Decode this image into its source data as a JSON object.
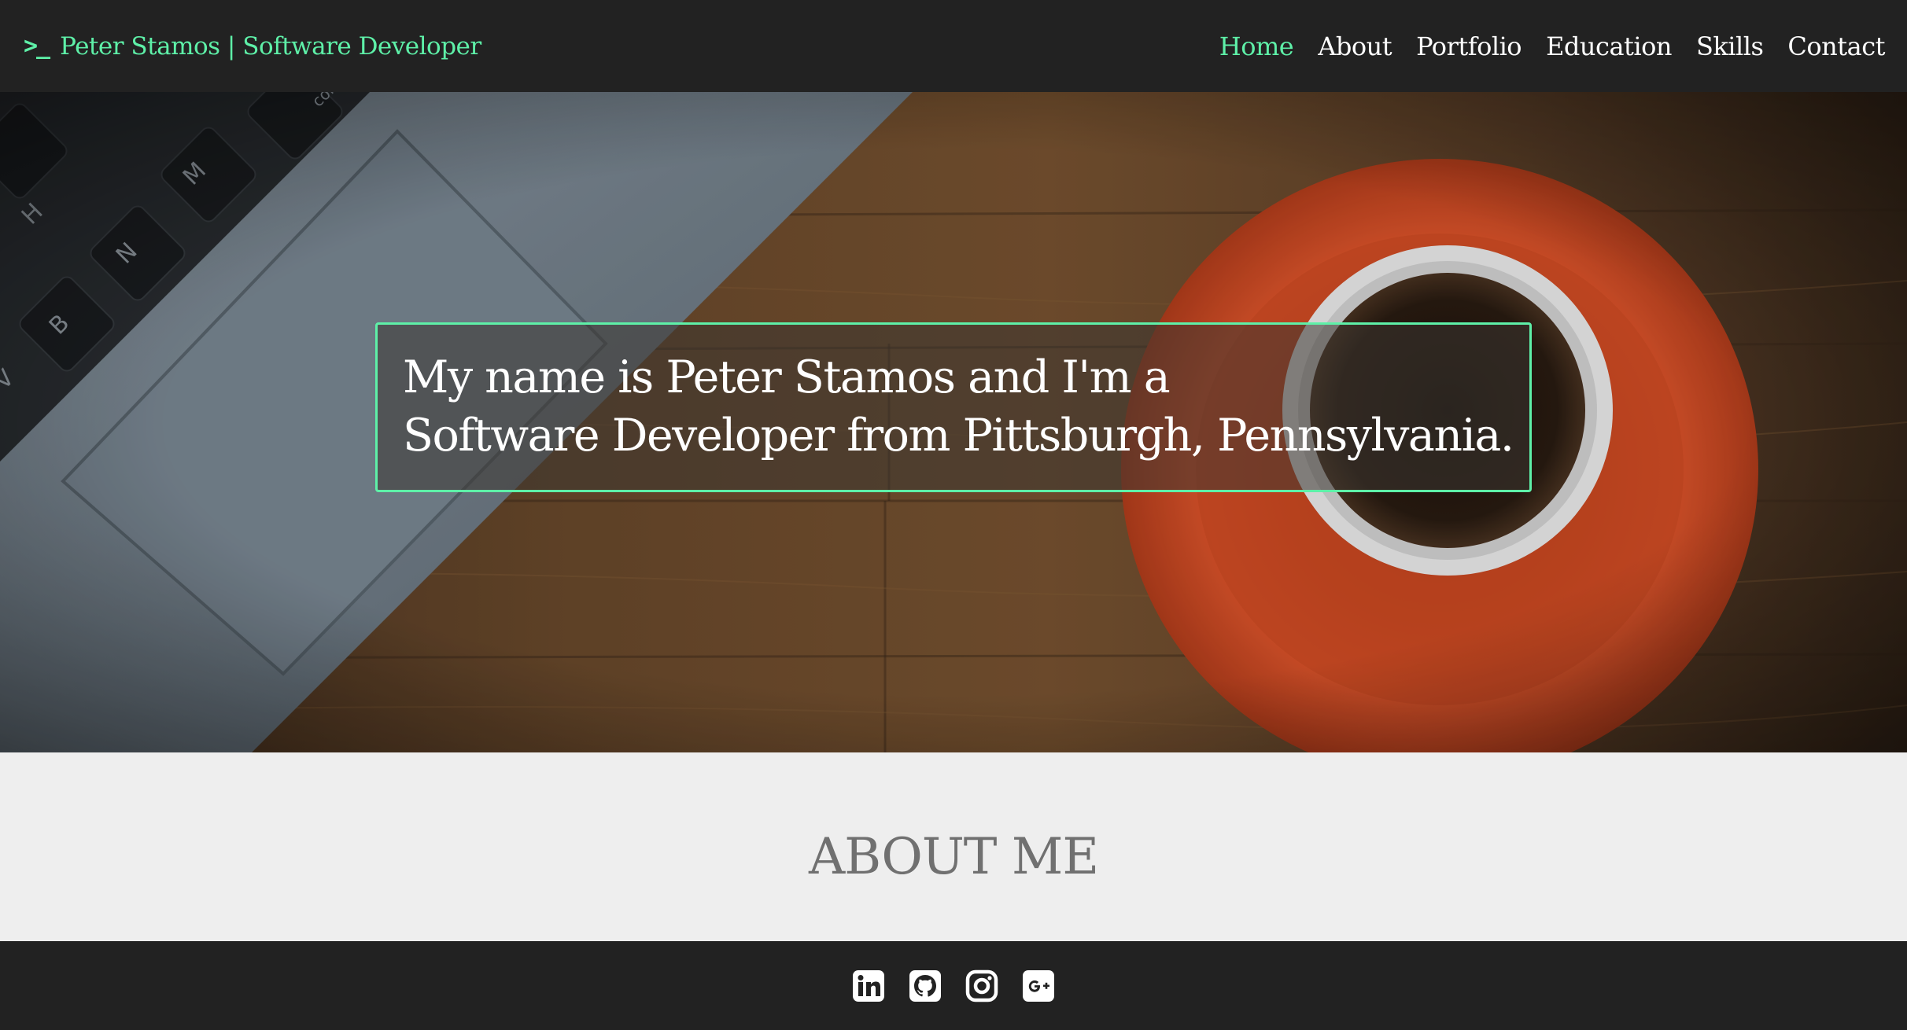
{
  "navbar": {
    "brand_prompt": ">_",
    "brand_title": "Peter Stamos | Software Developer",
    "links": [
      {
        "label": "Home",
        "active": true
      },
      {
        "label": "About",
        "active": false
      },
      {
        "label": "Portfolio",
        "active": false
      },
      {
        "label": "Education",
        "active": false
      },
      {
        "label": "Skills",
        "active": false
      },
      {
        "label": "Contact",
        "active": false
      }
    ]
  },
  "hero": {
    "line1": "My name is Peter Stamos and I'm a",
    "line2": "Software Developer from Pittsburgh, Pennsylvania.",
    "keyboard_keys": [
      "H",
      "N",
      "M",
      "B",
      "V",
      "com"
    ]
  },
  "about": {
    "heading": "ABOUT ME"
  },
  "footer": {
    "icons": [
      "linkedin-icon",
      "github-icon",
      "instagram-icon",
      "google-plus-icon"
    ]
  },
  "colors": {
    "accent": "#5ef0a8",
    "navbar_bg": "#222222",
    "page_bg": "#eeeeee",
    "heading_gray": "#707070",
    "saucer_orange": "#e0522a"
  }
}
